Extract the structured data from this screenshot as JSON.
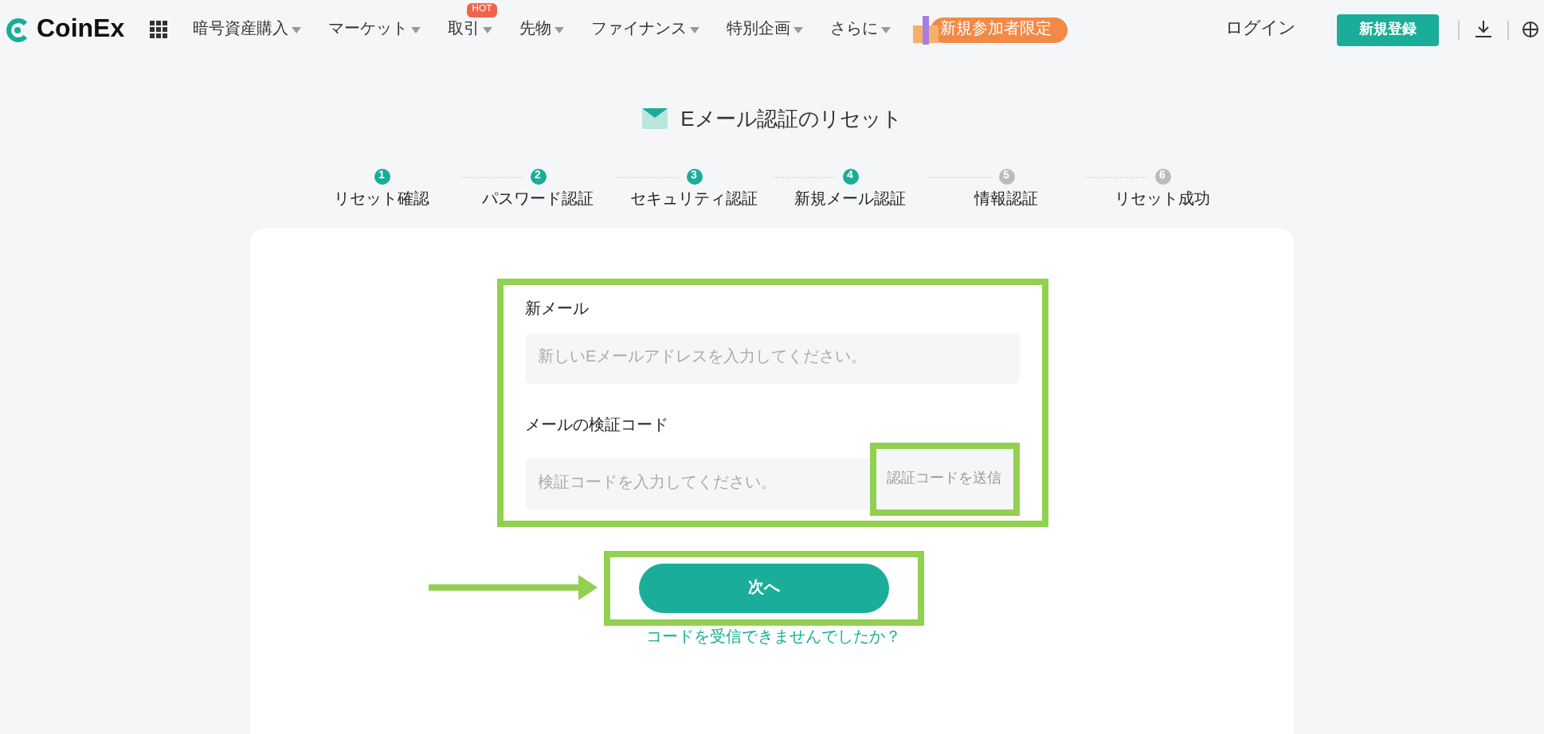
{
  "header": {
    "logo": "CoinEx",
    "nav": [
      {
        "label": "暗号資産購入"
      },
      {
        "label": "マーケット"
      },
      {
        "label": "取引",
        "badge": "HOT"
      },
      {
        "label": "先物"
      },
      {
        "label": "ファイナンス"
      },
      {
        "label": "特別企画"
      },
      {
        "label": "さらに"
      }
    ],
    "promo": "新規参加者限定",
    "login": "ログイン",
    "signup": "新規登録"
  },
  "title": "Eメール認証のリセット",
  "steps": [
    {
      "number": "1",
      "label": "リセット確認",
      "done": true
    },
    {
      "number": "2",
      "label": "パスワード認証",
      "done": true
    },
    {
      "number": "3",
      "label": "セキュリティ認証",
      "done": true
    },
    {
      "number": "4",
      "label": "新規メール認証",
      "done": true
    },
    {
      "number": "5",
      "label": "情報認証",
      "done": false
    },
    {
      "number": "6",
      "label": "リセット成功",
      "done": false
    }
  ],
  "form": {
    "email_label": "新メール",
    "email_placeholder": "新しいEメールアドレスを入力してください。",
    "code_label": "メールの検証コード",
    "code_placeholder": "検証コードを入力してください。",
    "send_code": "認証コードを送信",
    "next": "次へ",
    "help_link": "コードを受信できませんでしたか？"
  }
}
